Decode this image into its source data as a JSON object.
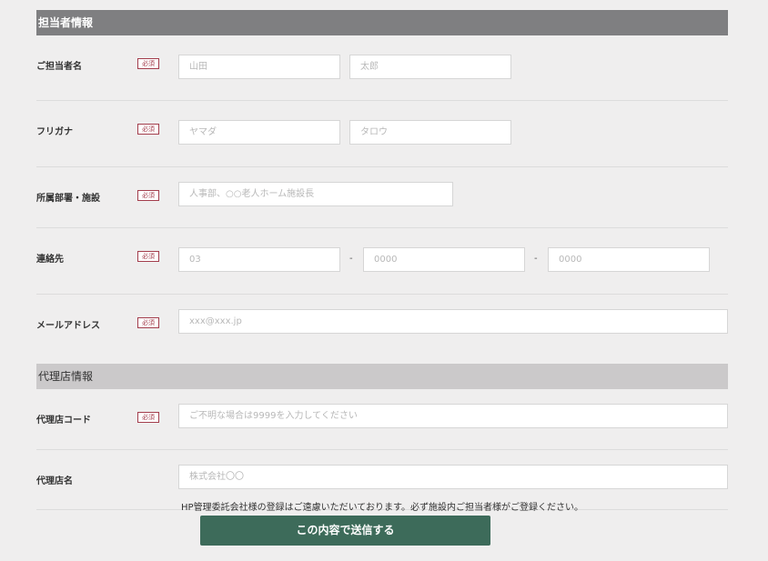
{
  "sections": {
    "contact_title": "担当者情報",
    "agency_title": "代理店情報"
  },
  "required_badge": "必須",
  "fields": {
    "name": {
      "label": "ご担当者名",
      "last_placeholder": "山田",
      "first_placeholder": "太郎"
    },
    "furigana": {
      "label": "フリガナ",
      "last_placeholder": "ヤマダ",
      "first_placeholder": "タロウ"
    },
    "department": {
      "label": "所属部署・施設",
      "placeholder": "人事部、○○老人ホーム施設長"
    },
    "phone": {
      "label": "連絡先",
      "p1": "03",
      "p2": "0000",
      "p3": "0000",
      "sep": "-"
    },
    "email": {
      "label": "メールアドレス",
      "placeholder": "xxx@xxx.jp"
    },
    "agency_code": {
      "label": "代理店コード",
      "placeholder": "ご不明な場合は9999を入力してください"
    },
    "agency_name": {
      "label": "代理店名",
      "placeholder": "株式会社〇〇"
    }
  },
  "note": "HP管理委託会社様の登録はご遠慮いただいております。必ず施設内ご担当者様がご登録ください。",
  "submit_label": "この内容で送信する"
}
